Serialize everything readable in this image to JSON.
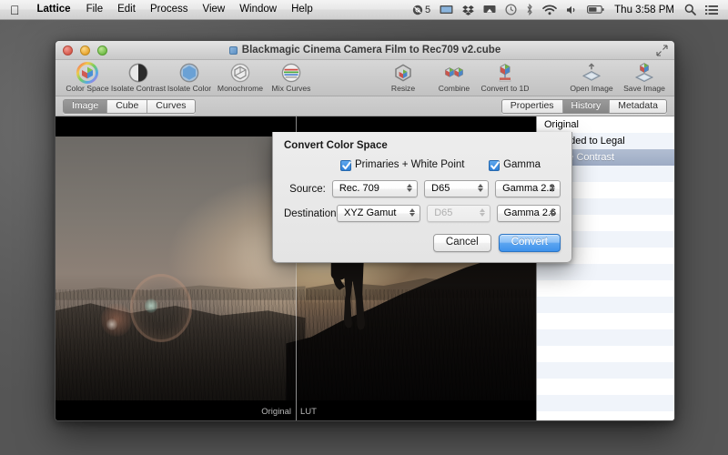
{
  "menubar": {
    "apple_icon": "apple-logo-icon",
    "app_name": "Lattice",
    "items": [
      "File",
      "Edit",
      "Process",
      "View",
      "Window",
      "Help"
    ],
    "status": {
      "dropzone_count": "5",
      "icons": [
        "dropzone-icon",
        "display-icon",
        "dropbox-icon",
        "airplay-icon",
        "time-machine-icon",
        "bluetooth-icon",
        "wifi-icon",
        "volume-icon",
        "battery-icon"
      ],
      "clock": "Thu 3:58 PM",
      "spotlight_icon": "search-icon",
      "notification_center_icon": "list-icon"
    }
  },
  "window": {
    "title": "Blackmagic Cinema Camera Film to Rec709 v2.cube",
    "traffic_lights": [
      "close",
      "minimize",
      "zoom"
    ],
    "fullscreen_icon": "fullscreen-arrows-icon"
  },
  "toolbar": {
    "left": [
      {
        "label": "Color Space",
        "icon": "color-wheel-cube-icon"
      },
      {
        "label": "Isolate Contrast",
        "icon": "contrast-circle-icon"
      },
      {
        "label": "Isolate Color",
        "icon": "color-sphere-icon"
      },
      {
        "label": "Monochrome",
        "icon": "grey-cube-icon"
      },
      {
        "label": "Mix Curves",
        "icon": "rgb-curves-icon"
      }
    ],
    "center": [
      {
        "label": "Resize",
        "icon": "resize-cube-icon"
      },
      {
        "label": "Combine",
        "icon": "combine-cubes-icon"
      },
      {
        "label": "Convert to 1D",
        "icon": "convert-1d-icon"
      }
    ],
    "right": [
      {
        "label": "Open Image",
        "icon": "open-image-icon"
      },
      {
        "label": "Save Image",
        "icon": "save-image-icon"
      }
    ]
  },
  "view_tabs": {
    "items": [
      "Image",
      "Cube",
      "Curves"
    ],
    "active": "Image"
  },
  "inspector_tabs": {
    "items": [
      "Properties",
      "History",
      "Metadata"
    ],
    "active": "History"
  },
  "history": {
    "entries": [
      "Original",
      "Extended to Legal",
      "Isolate Contrast"
    ],
    "selected": "Isolate Contrast",
    "selection_color": "#9dabc4",
    "stripe_color": "#f0f4fa"
  },
  "preview": {
    "label_left": "Original",
    "label_right": "LUT"
  },
  "sheet": {
    "title": "Convert Color Space",
    "checkboxes": [
      {
        "label": "Primaries + White Point",
        "checked": true
      },
      {
        "label": "Gamma",
        "checked": true
      }
    ],
    "checkbox_color": "#2f7fd6",
    "rows": [
      {
        "label": "Source:",
        "gamut": "Rec. 709",
        "white_point": "D65",
        "white_point_disabled": false,
        "gamma": "Gamma 2.2"
      },
      {
        "label": "Destination:",
        "gamut": "XYZ Gamut",
        "white_point": "D65",
        "white_point_disabled": true,
        "gamma": "Gamma 2.6"
      }
    ],
    "buttons": {
      "cancel": "Cancel",
      "convert": "Convert",
      "default_button_color": "#3e92ec"
    }
  }
}
